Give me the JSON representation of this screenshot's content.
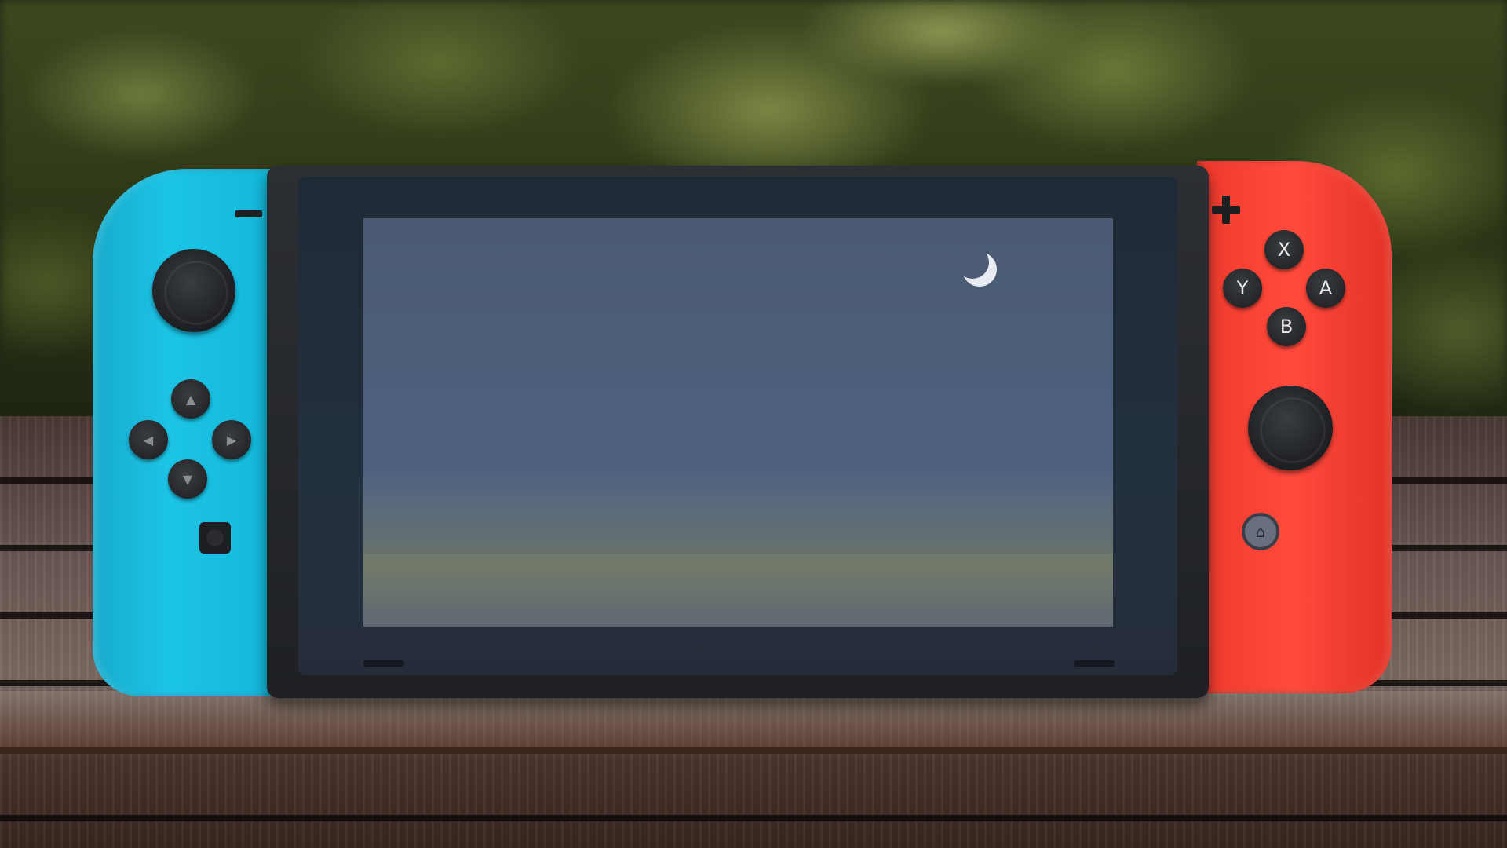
{
  "scene": {
    "subject": "",
    "colors": {
      "left_joycon": "#1cc4e6",
      "right_joycon": "#ff4a3c",
      "console_body": "#2c2f33",
      "screen": "#4d5e79"
    }
  },
  "left_joycon": {
    "icons": [
      "minus-icon",
      "left-stick-icon",
      "dpad-up-icon",
      "dpad-left-icon",
      "dpad-right-icon",
      "dpad-down-icon",
      "capture-icon"
    ],
    "dpad_glyphs": {
      "up": "▲",
      "left": "◀",
      "right": "▶",
      "down": "▼"
    }
  },
  "right_joycon": {
    "buttons": {
      "x": "X",
      "y": "Y",
      "a": "A",
      "b": "B"
    },
    "home_glyph": "⌂",
    "icons": [
      "plus-icon",
      "right-stick-icon",
      "home-icon"
    ]
  },
  "screen": {
    "icons": [
      "moon-icon"
    ]
  }
}
